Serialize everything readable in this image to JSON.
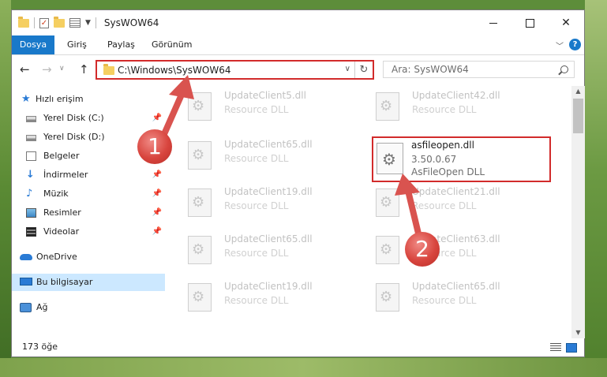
{
  "window": {
    "title": "SysWOW64",
    "title_separator": "|",
    "controls": {
      "minimize": "minimize",
      "maximize": "maximize",
      "close": "✕"
    }
  },
  "ribbon": {
    "tabs": [
      {
        "label": "Dosya",
        "active": true
      },
      {
        "label": "Giriş"
      },
      {
        "label": "Paylaş"
      },
      {
        "label": "Görünüm"
      }
    ],
    "help": "?"
  },
  "address": {
    "path": "C:\\Windows\\SysWOW64",
    "refresh": "↻"
  },
  "search": {
    "placeholder": "Ara: SysWOW64"
  },
  "sidebar": {
    "items": [
      {
        "label": "Hızlı erişim",
        "icon": "star-icon",
        "pinned": false
      },
      {
        "label": "Yerel Disk (C:)",
        "icon": "drive-icon",
        "pinned": true
      },
      {
        "label": "Yerel Disk (D:)",
        "icon": "drive-icon",
        "pinned": false
      },
      {
        "label": "Belgeler",
        "icon": "documents-icon",
        "pinned": true
      },
      {
        "label": "İndirmeler",
        "icon": "download-icon",
        "pinned": true
      },
      {
        "label": "Müzik",
        "icon": "music-icon",
        "pinned": true
      },
      {
        "label": "Resimler",
        "icon": "pictures-icon",
        "pinned": true
      },
      {
        "label": "Videolar",
        "icon": "videos-icon",
        "pinned": true
      },
      {
        "label": "OneDrive",
        "icon": "cloud-icon",
        "pinned": false
      },
      {
        "label": "Bu bilgisayar",
        "icon": "computer-icon",
        "pinned": false,
        "selected": true
      },
      {
        "label": "Ağ",
        "icon": "network-icon",
        "pinned": false
      }
    ]
  },
  "files": [
    {
      "name": "UpdateClient5.dll",
      "type": "Resource DLL"
    },
    {
      "name": "UpdateClient42.dll",
      "type": "Resource DLL"
    },
    {
      "name": "UpdateClient65.dll",
      "type": "Resource DLL"
    },
    {
      "name": "UpdateClient19.dll",
      "type": "Resource DLL"
    },
    {
      "name": "UpdateClient21.dll",
      "type": "Resource DLL"
    },
    {
      "name": "UpdateClient65.dll",
      "type": "Resource DLL"
    },
    {
      "name": "UpdateClient63.dll",
      "type": "Resource DLL"
    },
    {
      "name": "UpdateClient19.dll",
      "type": "Resource DLL"
    },
    {
      "name": "UpdateClient65.dll",
      "type": "Resource DLL"
    }
  ],
  "highlighted_file": {
    "name": "asfileopen.dll",
    "version": "3.50.0.67",
    "description": "AsFileOpen DLL"
  },
  "status": {
    "item_count": "173 öğe"
  },
  "annotations": {
    "step1": "1",
    "step2": "2",
    "color": "#d22b2b"
  }
}
